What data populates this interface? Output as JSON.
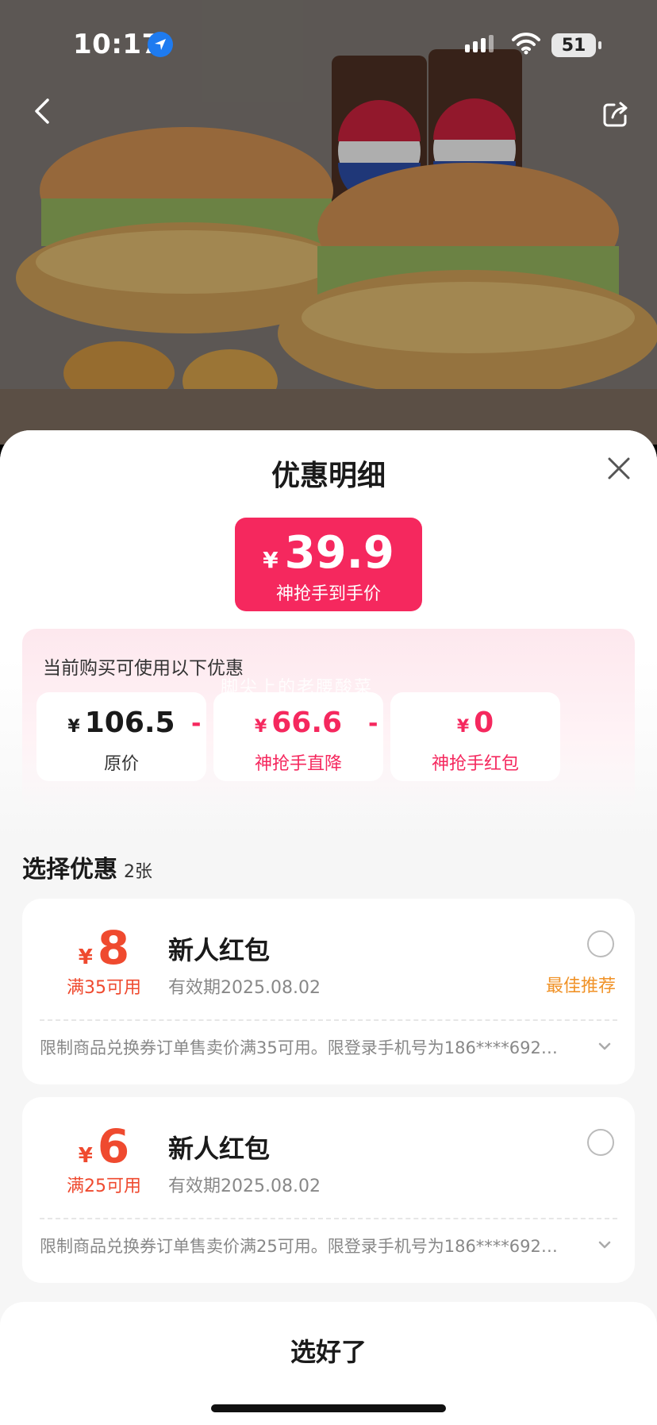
{
  "status_bar": {
    "time": "10:17",
    "battery": "51"
  },
  "sheet": {
    "title": "优惠明细",
    "final_price": {
      "currency": "¥",
      "amount": "39.9",
      "label": "神抢手到手价"
    },
    "breakdown": {
      "hint": "当前购买可使用以下优惠",
      "watermark": "脚尖上的老腰酸菜",
      "items": [
        {
          "currency": "¥",
          "amount": "106.5",
          "label": "原价"
        },
        {
          "currency": "¥",
          "amount": "66.6",
          "label": "神抢手直降"
        },
        {
          "currency": "¥",
          "amount": "0",
          "label": "神抢手红包"
        }
      ],
      "operator": "-"
    },
    "select": {
      "title": "选择优惠",
      "count": "2张"
    },
    "coupons": [
      {
        "currency": "¥",
        "value": "8",
        "condition": "满35可用",
        "name": "新人红包",
        "expiry": "有效期2025.08.02",
        "badge": "最佳推荐",
        "desc": "限制商品兑换券订单售卖价满35可用。限登录手机号为186****6925…"
      },
      {
        "currency": "¥",
        "value": "6",
        "condition": "满25可用",
        "name": "新人红包",
        "expiry": "有效期2025.08.02",
        "badge": "",
        "desc": "限制商品兑换券订单售卖价满25可用。限登录手机号为186****6925…"
      }
    ],
    "confirm_label": "选好了"
  },
  "colors": {
    "accent": "#f5285e",
    "coupon_red": "#ef4a2f",
    "badge_orange": "#f09227"
  }
}
